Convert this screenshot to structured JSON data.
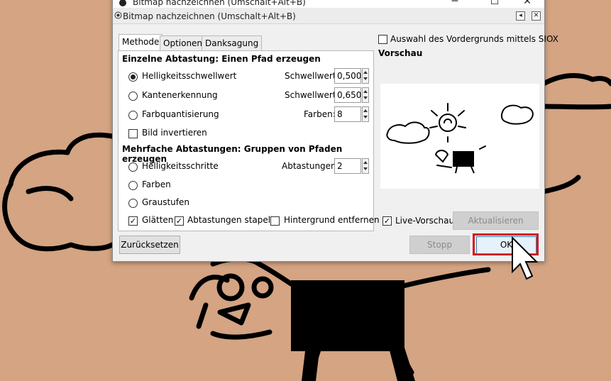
{
  "window": {
    "title": "Bitmap nachzeichnen (Umschalt+Alt+B)",
    "dock_title": "Bitmap nachzeichnen (Umschalt+Alt+B)",
    "minimize": "─",
    "maximize": "☐",
    "close": "✕"
  },
  "tabs": [
    {
      "label": "Methode",
      "active": true
    },
    {
      "label": "Optionen",
      "active": false
    },
    {
      "label": "Danksagung",
      "active": false
    }
  ],
  "single_scan": {
    "heading": "Einzelne Abtastung: Einen Pfad erzeugen",
    "options": [
      {
        "label": "Helligkeitsschwellwert",
        "checked": true,
        "param_label": "Schwellwert:",
        "value": "0,500"
      },
      {
        "label": "Kantenerkennung",
        "checked": false,
        "param_label": "Schwellwert:",
        "value": "0,650"
      },
      {
        "label": "Farbquantisierung",
        "checked": false,
        "param_label": "Farben:",
        "value": "8"
      }
    ],
    "invert": {
      "label": "Bild invertieren",
      "checked": false
    }
  },
  "multi_scan": {
    "heading": "Mehrfache Abtastungen: Gruppen von Pfaden erzeugen",
    "options": [
      {
        "label": "Helligkeitsschritte",
        "checked": false,
        "param_label": "Abtastungen:",
        "value": "2"
      },
      {
        "label": "Farben",
        "checked": false
      },
      {
        "label": "Graustufen",
        "checked": false
      }
    ],
    "smooth": {
      "label": "Glätten",
      "checked": true
    },
    "stack": {
      "label": "Abtastungen stapeln",
      "checked": true
    },
    "remove_bg": {
      "label": "Hintergrund entfernen",
      "checked": false
    }
  },
  "siox": {
    "label": "Auswahl des Vordergrunds mittels SIOX",
    "checked": false
  },
  "preview": {
    "heading": "Vorschau",
    "live": {
      "label": "Live-Vorschau",
      "checked": true
    },
    "update_button": "Aktualisieren"
  },
  "buttons": {
    "reset": "Zurücksetzen",
    "stop": "Stopp",
    "ok": "OK"
  },
  "colors": {
    "canvas_bg": "#d4a483",
    "highlight": "#d7141a",
    "ok_focus": "#3c7fb1"
  }
}
